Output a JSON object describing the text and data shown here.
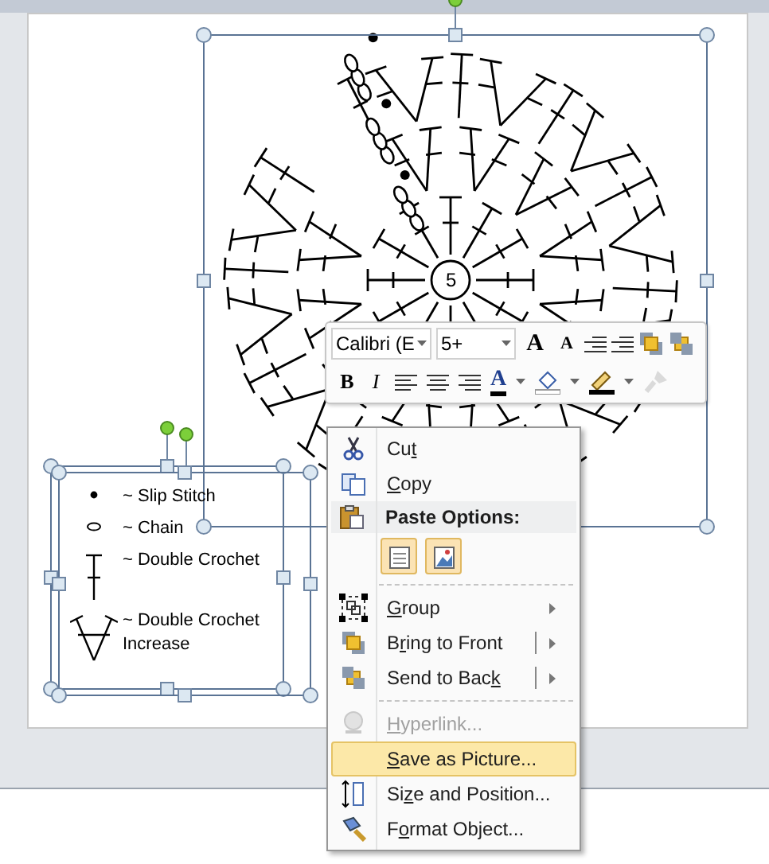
{
  "chart": {
    "center_label": "5"
  },
  "legend": [
    {
      "kind": "slip",
      "label": "~ Slip Stitch"
    },
    {
      "kind": "chain",
      "label": "~ Chain"
    },
    {
      "kind": "dc",
      "label": "~ Double Crochet"
    },
    {
      "kind": "increase",
      "label": "~ Double Crochet Increase"
    }
  ],
  "mini_toolbar": {
    "font": "Calibri (E",
    "size": "5+",
    "grow_label": "A",
    "shrink_label": "A",
    "bold_label": "B",
    "italic_label": "I",
    "font_color_label": "A",
    "format_painter_disabled": true
  },
  "context_menu": {
    "items": [
      {
        "kind": "item",
        "before": "Cu",
        "access_key": "t",
        "disabled": false,
        "selected": false
      },
      {
        "kind": "item",
        "access_key": "C",
        "after": "opy",
        "disabled": false,
        "selected": false
      },
      {
        "kind": "header",
        "label": "Paste Options:"
      },
      {
        "kind": "paste_row",
        "options": [
          {
            "kind": "document"
          },
          {
            "kind": "picture"
          }
        ]
      },
      {
        "kind": "separator"
      },
      {
        "kind": "submenu_item",
        "access_key": "G",
        "after": "roup",
        "disabled": false,
        "selected": false
      },
      {
        "kind": "split_item",
        "before": "B",
        "access_key": "r",
        "after": "ing to Front",
        "disabled": false,
        "selected": false
      },
      {
        "kind": "split_item",
        "before": "Send to Bac",
        "access_key": "k",
        "disabled": false,
        "selected": false
      },
      {
        "kind": "separator"
      },
      {
        "kind": "item",
        "access_key": "H",
        "after": "yperlink...",
        "disabled": true,
        "selected": false
      },
      {
        "kind": "item",
        "access_key": "S",
        "after": "ave as Picture...",
        "disabled": false,
        "selected": true
      },
      {
        "kind": "item",
        "before": "Si",
        "access_key": "z",
        "after": "e and Position...",
        "disabled": false,
        "selected": false
      },
      {
        "kind": "item",
        "before": "F",
        "access_key": "o",
        "after": "rmat Object...",
        "disabled": false,
        "selected": false
      }
    ]
  }
}
